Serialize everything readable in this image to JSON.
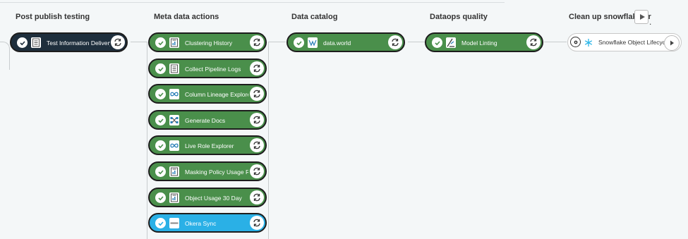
{
  "stages": [
    {
      "title": "Post publish testing"
    },
    {
      "title": "Meta data actions"
    },
    {
      "title": "Data catalog"
    },
    {
      "title": "Dataops quality"
    },
    {
      "title": "Clean up snowflake or"
    }
  ],
  "title_overflow": ".",
  "jobs": {
    "post_publish": [
      {
        "label": "Test Information Delivery",
        "icon": "document-icon",
        "status": "success"
      }
    ],
    "meta_data": [
      {
        "label": "Clustering History",
        "icon": "report-icon",
        "status": "success"
      },
      {
        "label": "Collect Pipeline Logs",
        "icon": "document-icon",
        "status": "success"
      },
      {
        "label": "Column Lineage Explorer",
        "icon": "infinity-icon",
        "status": "success"
      },
      {
        "label": "Generate Docs",
        "icon": "docs-diagram-icon",
        "status": "success"
      },
      {
        "label": "Live Role Explorer",
        "icon": "infinity-icon",
        "status": "success"
      },
      {
        "label": "Masking Policy Usage Rep",
        "icon": "report-icon",
        "status": "success"
      },
      {
        "label": "Object Usage 30 Day",
        "icon": "report-icon",
        "status": "success"
      },
      {
        "label": "Okera Sync",
        "icon": "okera-icon",
        "status": "success"
      }
    ],
    "data_catalog": [
      {
        "label": "data.world",
        "icon": "data-world-icon",
        "status": "success"
      }
    ],
    "dataops_quality": [
      {
        "label": "Model Linting",
        "icon": "lint-icon",
        "status": "success"
      }
    ],
    "cleanup": [
      {
        "label": "Snowflake Object Lifecycle",
        "icon": "snowflake-icon",
        "status": "manual"
      }
    ]
  },
  "colors": {
    "success": "#4a8f4b",
    "running": "#2ab0e6",
    "dark": "#1f2f3d"
  }
}
